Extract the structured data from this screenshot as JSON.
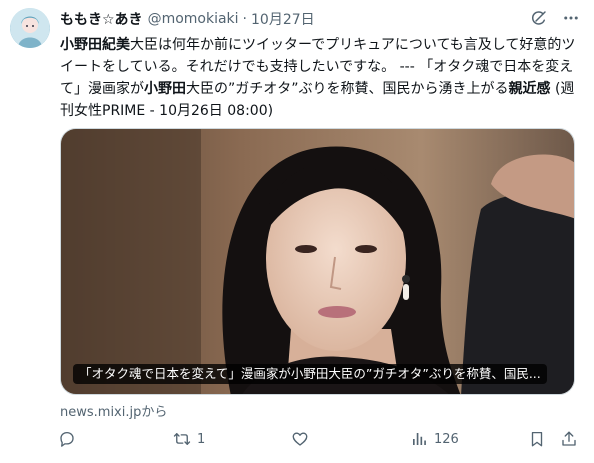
{
  "author": {
    "display_name": "ももき☆あき",
    "handle": "@momokiaki",
    "separator": "·",
    "time": "10月27日"
  },
  "tweet": {
    "seg1_bold": "小野田紀美",
    "seg2": "大臣は何年か前にツイッターでプリキュアについても言及して好意的ツイートをしている。それだけでも支持したいですな。 --- 「オタク魂で日本を変えて」漫画家が",
    "seg3_bold": "小野田",
    "seg4": "大臣の”ガチオタ”ぶりを称賛、国民から湧き上がる",
    "seg5_bold": "親近感",
    "seg6": " (週刊女性PRIME - 10月26日 08:00)"
  },
  "card": {
    "caption": "「オタク魂で日本を変えて」漫画家が小野田大臣の”ガチオタ”ぶりを称賛、国民...",
    "source": "news.mixi.jpから"
  },
  "actions": {
    "reply_count": "",
    "repost_count": "1",
    "like_count": "",
    "views_count": "126"
  },
  "icons": {
    "header": [
      "grok-icon",
      "more-icon"
    ],
    "actions": [
      "reply-icon",
      "repost-icon",
      "like-icon",
      "views-icon",
      "bookmark-icon",
      "share-icon"
    ]
  },
  "colors": {
    "text": "#0f1419",
    "secondary": "#536471",
    "border": "#cfd9de"
  }
}
